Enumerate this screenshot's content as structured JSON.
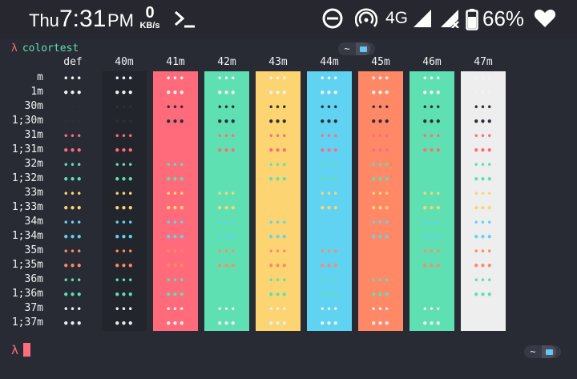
{
  "statusbar": {
    "day": "Thu",
    "time": "7:31",
    "ampm": "PM",
    "speed_value": "0",
    "speed_unit": "KB/s",
    "network": "4G",
    "battery_percent": "66%",
    "icons": [
      "terminal-icon",
      "do-not-disturb-icon",
      "hotspot-icon",
      "signal-icon",
      "no-signal-icon",
      "battery-icon",
      "heart-icon"
    ]
  },
  "terminal": {
    "prompt_symbol": "λ",
    "command": "colortest",
    "badge_text": "~",
    "columns": [
      "def",
      "40m",
      "41m",
      "42m",
      "43m",
      "44m",
      "45m",
      "46m",
      "47m"
    ],
    "rows": [
      "m",
      "1m",
      "30m",
      "1;30m",
      "31m",
      "1;31m",
      "32m",
      "1;32m",
      "33m",
      "1;33m",
      "34m",
      "1;34m",
      "35m",
      "1;35m",
      "36m",
      "1;36m",
      "37m",
      "1;37m"
    ],
    "cell_text": "•••",
    "colors": {
      "background": "#282a34",
      "bg40": "#22252b",
      "bg41": "#ff6b7b",
      "bg42": "#5ee0b3",
      "bg43": "#fcd471",
      "bg44": "#60d3f2",
      "bg45": "#ff8966",
      "bg46": "#5ee0b3",
      "bg47": "#eeeeee",
      "fg30": "#2b2e36",
      "fg31": "#ff6b7b",
      "fg32": "#5ee0b3",
      "fg33": "#fcd471",
      "fg34": "#60d3f2",
      "fg35": "#ff8966",
      "fg36": "#5ee0b3",
      "fg37": "#eeeeee"
    }
  }
}
